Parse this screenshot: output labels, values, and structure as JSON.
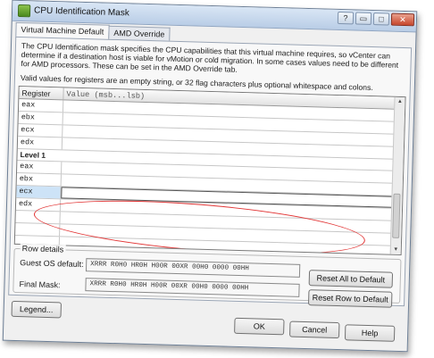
{
  "window": {
    "title": "CPU Identification Mask",
    "controls": {
      "help": "?",
      "restore": "▭",
      "maximize": "□",
      "close": "✕"
    }
  },
  "tabs": [
    {
      "label": "Virtual Machine Default"
    },
    {
      "label": "AMD Override"
    }
  ],
  "description": "The CPU Identification mask specifies the CPU capabilities that this virtual machine requires, so vCenter can determine if a destination host is viable for vMotion or cold migration. In some cases values need to be different for AMD processors. These can be set in the AMD Override tab.",
  "hint": "Valid values for registers are an empty string, or 32 flag characters plus optional whitespace and colons.",
  "grid": {
    "col_register": "Register",
    "col_value": "Value (msb...lsb)",
    "rows": [
      {
        "register": "eax",
        "value": ""
      },
      {
        "register": "ebx",
        "value": ""
      },
      {
        "register": "ecx",
        "value": ""
      },
      {
        "register": "edx",
        "value": ""
      },
      {
        "register": "Level 1",
        "value": ""
      },
      {
        "register": "eax",
        "value": ""
      },
      {
        "register": "ebx",
        "value": ""
      },
      {
        "register": "ecx",
        "value": ""
      },
      {
        "register": "edx",
        "value": ""
      }
    ]
  },
  "row_details": {
    "legend": "Row details",
    "guest_os_label": "Guest OS default:",
    "guest_os_value": "XRRR R0H0 HR0H H00R 00XR 00H0 0000 00HH",
    "final_mask_label": "Final Mask:",
    "final_mask_value": "XRRR R0H0 HR0H H00R 00XR 00H0 0000 00HH"
  },
  "buttons": {
    "reset_all": "Reset All to Default",
    "reset_row": "Reset Row to Default",
    "legend": "Legend...",
    "ok": "OK",
    "cancel": "Cancel",
    "help": "Help"
  },
  "colors": {
    "selection": "#cde3f7",
    "annotation_circle": "#e23636"
  }
}
